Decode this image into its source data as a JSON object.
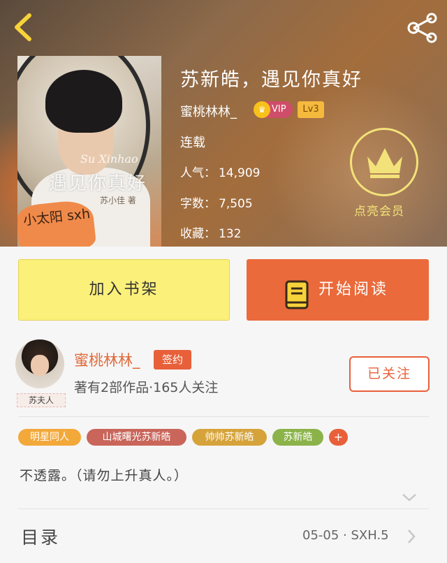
{
  "header": {
    "book_title": "苏新皓，遇见你真好",
    "author": "蜜桃林林_",
    "vip_label": "VIP",
    "level": "Lv3",
    "status": "连载",
    "stats": [
      {
        "label": "人气：",
        "value": "14,909"
      },
      {
        "label": "字数：",
        "value": "7,505"
      },
      {
        "label": "收藏：",
        "value": "132"
      }
    ],
    "vip_promo": "点亮会员",
    "icons": {
      "back": "back-arrow-icon",
      "share": "share-icon",
      "crown": "crown-icon"
    }
  },
  "cover": {
    "script_text": "Su Xinhao",
    "title_text": "遇见你真好",
    "sub_text": "苏小佳 著",
    "sticky_text": "小太阳 sxh"
  },
  "actions": {
    "add_shelf": "加入书架",
    "start_reading": "开始阅读"
  },
  "author_card": {
    "name": "蜜桃林林_",
    "sign_badge": "签约",
    "stats": "著有2部作品·165人关注",
    "avatar_tag": "苏夫人",
    "follow": "已关注"
  },
  "tags": [
    {
      "label": "明星同人",
      "color": "#f3a83a"
    },
    {
      "label": "山城曙光苏新皓",
      "color": "#c9655a"
    },
    {
      "label": "帅帅苏新皓",
      "color": "#d6a33b"
    },
    {
      "label": "苏新皓",
      "color": "#8bb34a"
    }
  ],
  "tag_add": "+",
  "description": "不透露。（请勿上升真人。）",
  "toc": {
    "label": "目录",
    "latest": "05-05 · SXH.5"
  },
  "colors": {
    "accent": "#e8603a",
    "shelf_button": "#fbf07a",
    "read_button": "#ea6a3b",
    "vip_gold": "#f3e27a"
  }
}
